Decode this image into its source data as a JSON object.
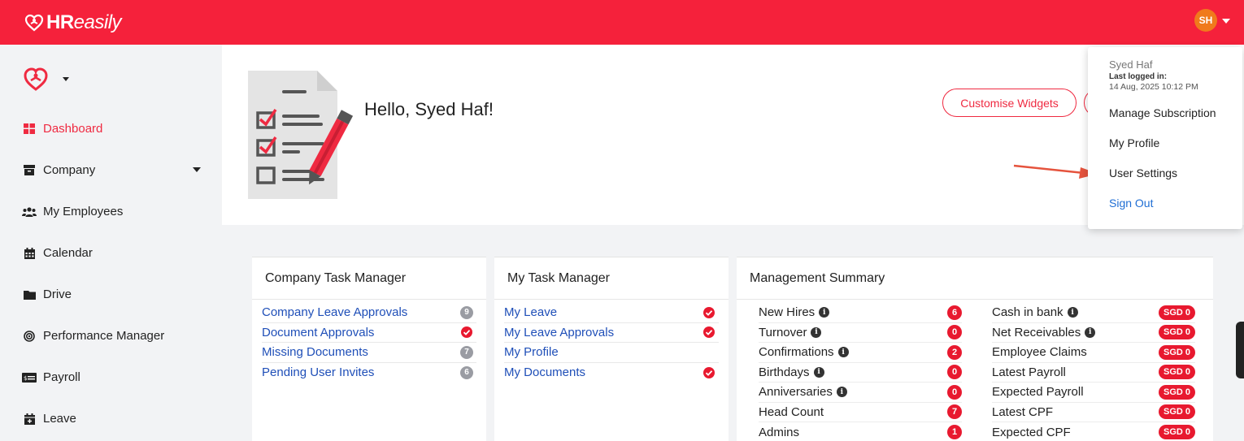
{
  "header": {
    "logo": {
      "bold": "HR",
      "italic": "easily"
    },
    "avatar_initials": "SH",
    "brand_color": "#f5213b"
  },
  "sidebar": {
    "items": [
      {
        "label": "Dashboard",
        "icon": "dashboard-icon",
        "active": true
      },
      {
        "label": "Company",
        "icon": "building-icon",
        "has_dropdown": true
      },
      {
        "label": "My Employees",
        "icon": "users-icon"
      },
      {
        "label": "Calendar",
        "icon": "calendar-icon"
      },
      {
        "label": "Drive",
        "icon": "folder-icon"
      },
      {
        "label": "Performance Manager",
        "icon": "target-icon"
      },
      {
        "label": "Payroll",
        "icon": "money-icon"
      },
      {
        "label": "Leave",
        "icon": "calendar-plus-icon"
      }
    ]
  },
  "hero": {
    "greeting": "Hello, Syed Haf!",
    "customise_label": "Customise Widgets"
  },
  "user_menu": {
    "name": "Syed Haf",
    "last_logged_label": "Last logged in:",
    "last_logged_time": "14 Aug, 2025 10:12 PM",
    "items": [
      "Manage Subscription",
      "My Profile",
      "User Settings",
      "Sign Out"
    ]
  },
  "company_task_manager": {
    "title": "Company Task Manager",
    "rows": [
      {
        "label": "Company Leave Approvals",
        "count": "9"
      },
      {
        "label": "Document Approvals",
        "status": "check"
      },
      {
        "label": "Missing Documents",
        "count": "7"
      },
      {
        "label": "Pending User Invites",
        "count": "6"
      }
    ]
  },
  "my_task_manager": {
    "title": "My Task Manager",
    "rows": [
      {
        "label": "My Leave",
        "status": "check"
      },
      {
        "label": "My Leave Approvals",
        "status": "check"
      },
      {
        "label": "My Profile",
        "status": ""
      },
      {
        "label": "My Documents",
        "status": "check"
      }
    ]
  },
  "management_summary": {
    "title": "Management Summary",
    "left": [
      {
        "label": "New Hires",
        "info": true,
        "value": "6"
      },
      {
        "label": "Turnover",
        "info": true,
        "value": "0"
      },
      {
        "label": "Confirmations",
        "info": true,
        "value": "2"
      },
      {
        "label": "Birthdays",
        "info": true,
        "value": "0"
      },
      {
        "label": "Anniversaries",
        "info": true,
        "value": "0"
      },
      {
        "label": "Head Count",
        "info": false,
        "value": "7"
      },
      {
        "label": "Admins",
        "info": false,
        "value": "1"
      }
    ],
    "right": [
      {
        "label": "Cash in bank",
        "info": true,
        "value": "SGD 0"
      },
      {
        "label": "Net Receivables",
        "info": true,
        "value": "SGD 0"
      },
      {
        "label": "Employee Claims",
        "info": false,
        "value": "SGD 0"
      },
      {
        "label": "Latest Payroll",
        "info": false,
        "value": "SGD 0"
      },
      {
        "label": "Expected Payroll",
        "info": false,
        "value": "SGD 0"
      },
      {
        "label": "Latest CPF",
        "info": false,
        "value": "SGD 0"
      },
      {
        "label": "Expected CPF",
        "info": false,
        "value": "SGD 0"
      }
    ]
  },
  "info_glyph": "i"
}
